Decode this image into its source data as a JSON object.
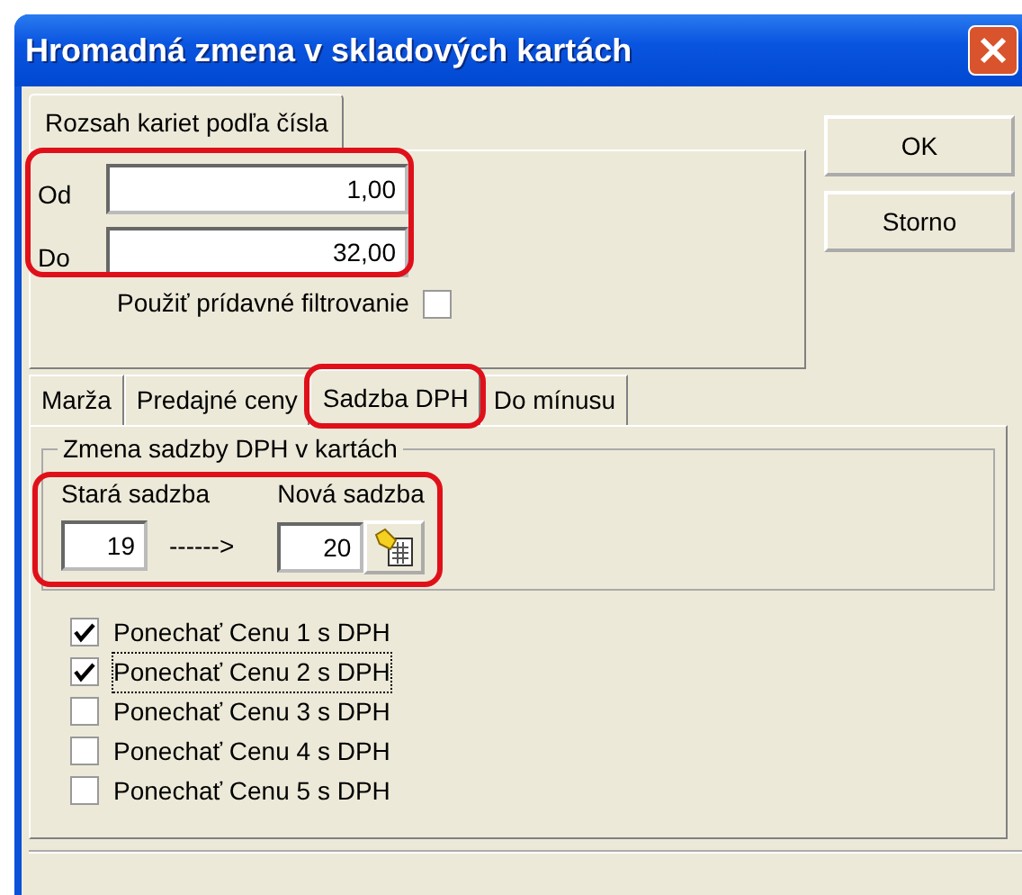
{
  "window": {
    "title": "Hromadná zmena v skladových kartách"
  },
  "range_tab": {
    "label": "Rozsah kariet podľa čísla"
  },
  "range": {
    "from_label": "Od",
    "from_value": "1,00",
    "to_label": "Do",
    "to_value": "32,00"
  },
  "extra_filter": {
    "label": "Použiť prídavné filtrovanie",
    "checked": false
  },
  "buttons": [
    "OK",
    "Storno"
  ],
  "tabs": [
    {
      "label": "Marža",
      "selected": false
    },
    {
      "label": "Predajné ceny",
      "selected": false
    },
    {
      "label": "Sadzba DPH",
      "selected": true
    },
    {
      "label": "Do mínusu",
      "selected": false
    }
  ],
  "vat_group": {
    "title": "Zmena sadzby DPH v kartách",
    "old_label": "Stará sadzba",
    "old_value": "19",
    "arrow": "------>",
    "new_label": "Nová sadzba",
    "new_value": "20"
  },
  "keep_prices": [
    {
      "label": "Ponechať Cenu 1 s DPH",
      "checked": true,
      "focused": false
    },
    {
      "label": "Ponechať Cenu 2 s DPH",
      "checked": true,
      "focused": true
    },
    {
      "label": "Ponechať Cenu 3 s DPH",
      "checked": false,
      "focused": false
    },
    {
      "label": "Ponechať Cenu 4 s DPH",
      "checked": false,
      "focused": false
    },
    {
      "label": "Ponechať Cenu 5 s DPH",
      "checked": false,
      "focused": false
    }
  ]
}
